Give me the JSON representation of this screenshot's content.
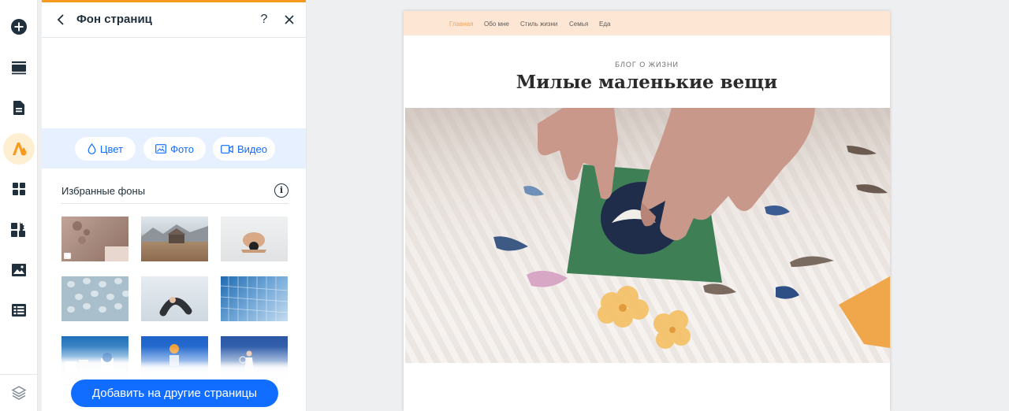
{
  "rail": {
    "items": [
      {
        "icon": "add-icon"
      },
      {
        "icon": "menus-icon"
      },
      {
        "icon": "pages-icon"
      },
      {
        "icon": "design-icon",
        "active": true
      },
      {
        "icon": "add-apps-icon"
      },
      {
        "icon": "my-business-icon"
      },
      {
        "icon": "media-icon"
      },
      {
        "icon": "cms-table-icon"
      }
    ],
    "bottom_icon": "layers-icon"
  },
  "panel": {
    "title": "Фон страниц",
    "help": "?",
    "tabs": [
      {
        "label": "Цвет",
        "icon": "drop-icon"
      },
      {
        "label": "Фото",
        "icon": "image-icon"
      },
      {
        "label": "Видео",
        "icon": "video-icon"
      }
    ],
    "section_title": "Избранные фоны",
    "info": "i",
    "thumbnails": [
      {
        "name": "dry-flowers-video",
        "video": true
      },
      {
        "name": "mountain-cabin"
      },
      {
        "name": "yoga-pose"
      },
      {
        "name": "blue-rolls-pattern"
      },
      {
        "name": "backbend-pose"
      },
      {
        "name": "glass-building"
      },
      {
        "name": "white-town-sea"
      },
      {
        "name": "orange-on-blue"
      },
      {
        "name": "tennis-player"
      }
    ],
    "add_button": "Добавить на другие страницы"
  },
  "site": {
    "nav": [
      "Главная",
      "Обо мне",
      "Стиль жизни",
      "Семья",
      "Еда"
    ],
    "active_nav": "Главная",
    "kicker": "БЛОГ О ЖИЗНИ",
    "title": "Милые маленькие вещи"
  },
  "colors": {
    "accent_blue": "#116dff",
    "accent_orange": "#f79a1e",
    "tab_bar_bg": "#e7f0ff",
    "site_nav_bg": "#fde6d3",
    "nav_active": "#f0a460"
  }
}
